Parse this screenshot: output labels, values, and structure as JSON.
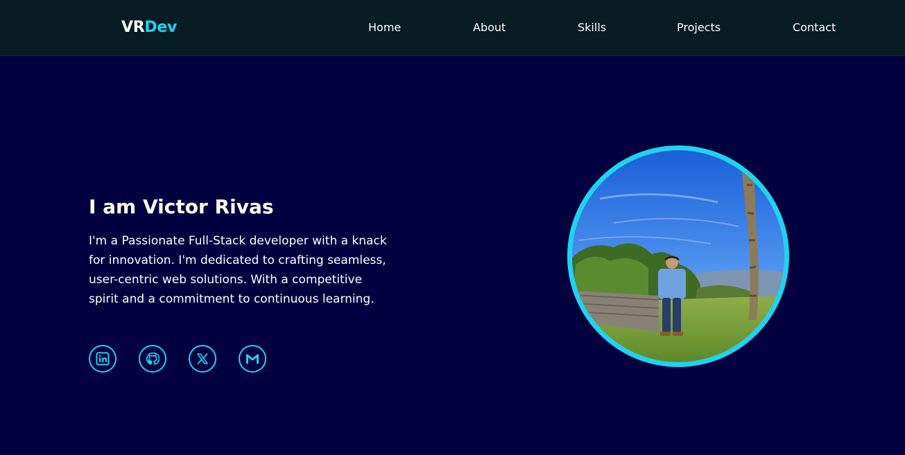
{
  "nav": {
    "brand_primary": "VR",
    "brand_accent": "Dev",
    "links": [
      "Home",
      "About",
      "Skills",
      "Projects",
      "Contact"
    ]
  },
  "hero": {
    "title": "I am Victor Rivas",
    "description": "I'm a Passionate Full-Stack developer with a knack for innovation. I'm dedicated to crafting seamless, user-centric web solutions. With a competitive spirit and a commitment to continuous learning.",
    "socials": [
      "linkedin-icon",
      "github-icon",
      "x-icon",
      "gmail-icon"
    ]
  },
  "colors": {
    "navbar_bg": "#081c24",
    "page_bg": "#02003f",
    "accent": "#1fd3f0",
    "text": "#ffffff"
  }
}
